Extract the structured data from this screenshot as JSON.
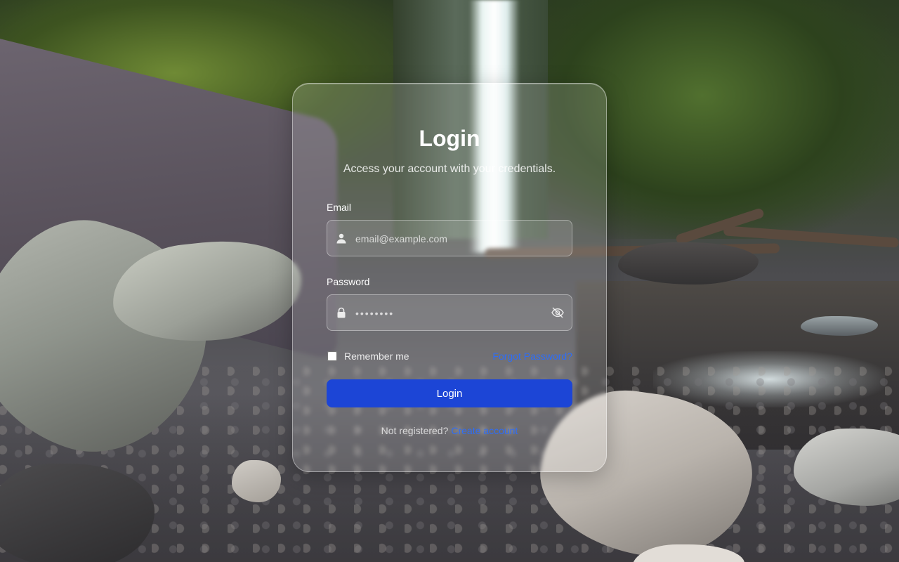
{
  "login": {
    "title": "Login",
    "subtitle": "Access your account with your credentials.",
    "email": {
      "label": "Email",
      "placeholder": "email@example.com",
      "value": "",
      "icon": "user-icon"
    },
    "password": {
      "label": "Password",
      "placeholder": "••••••••",
      "value": "",
      "icon": "lock-icon",
      "toggle_icon": "eye-off-icon"
    },
    "remember_label": "Remember me",
    "remember_checked": false,
    "forgot_label": "Forgot Password?",
    "submit_label": "Login",
    "signup_prompt": "Not registered?",
    "signup_link": "Create account"
  },
  "colors": {
    "primary": "#1c45d6",
    "link": "#2f6df5",
    "text": "#ffffff"
  },
  "background": {
    "icon": "waterfall-photo"
  }
}
